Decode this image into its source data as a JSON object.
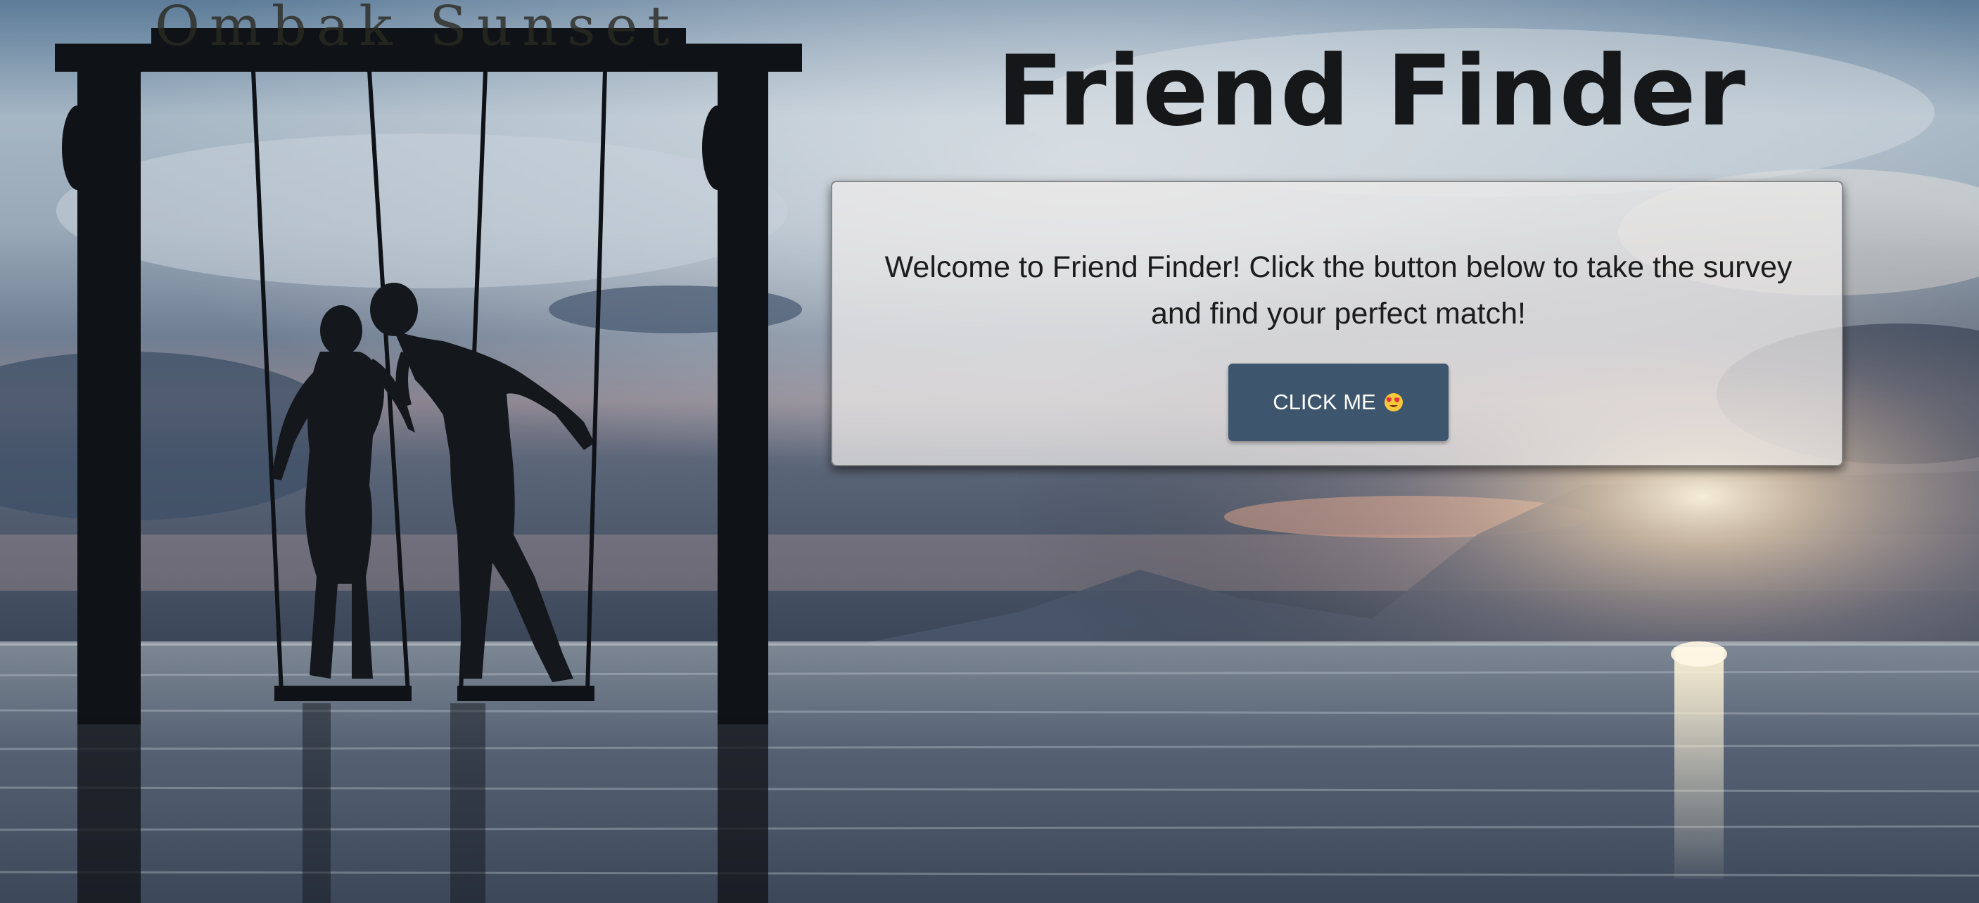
{
  "page": {
    "title": "Friend Finder"
  },
  "card": {
    "welcome_text": "Welcome to Friend Finder! Click the button below to take the survey and find your perfect match!",
    "button_label": "CLICK ME",
    "button_icon": "heart-eyes-emoji-icon"
  },
  "background": {
    "scene": "swing-sunset-photo",
    "sign_text": "Ombak Sunset"
  },
  "colors": {
    "button_bg": "#3d566e",
    "title_text": "#151719"
  }
}
